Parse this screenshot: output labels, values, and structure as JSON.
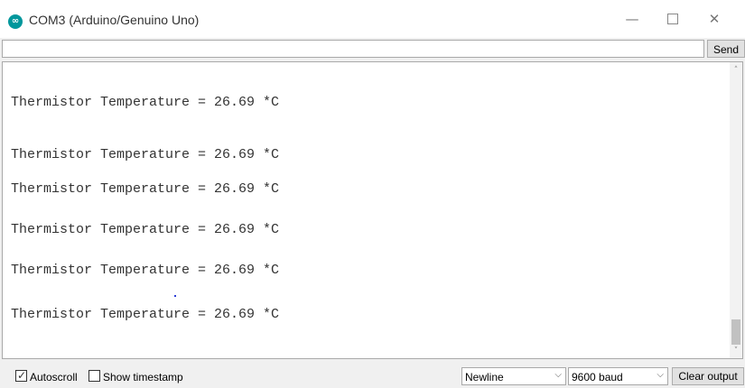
{
  "window": {
    "title": "COM3 (Arduino/Genuino Uno)",
    "logo_glyph": "∞",
    "logo_icon": "arduino-logo-icon",
    "accent": "#00979c",
    "controls": {
      "minimize": "—",
      "close": "✕"
    }
  },
  "send_bar": {
    "input_value": "",
    "send_label": "Send"
  },
  "output": {
    "lines": [
      "Thermistor Temperature = 26.69 *C",
      "Thermistor Temperature = 26.69 *C",
      "Thermistor Temperature = 26.69 *C",
      "Thermistor Temperature = 26.69 *C",
      "Thermistor Temperature = 26.69 *C",
      "Thermistor Temperature = 26.69 *C"
    ],
    "clipped_top_fragment": "r",
    "scroll_up": "˄",
    "scroll_down": "˅"
  },
  "status_bar": {
    "autoscroll": {
      "label": "Autoscroll",
      "checked": true,
      "mark": "✓"
    },
    "timestamp": {
      "label": "Show timestamp",
      "checked": false
    },
    "line_ending": {
      "value": "Newline",
      "chevron": "⌵"
    },
    "baud_rate": {
      "value": "9600 baud",
      "chevron": "⌵"
    },
    "clear_label": "Clear output"
  }
}
